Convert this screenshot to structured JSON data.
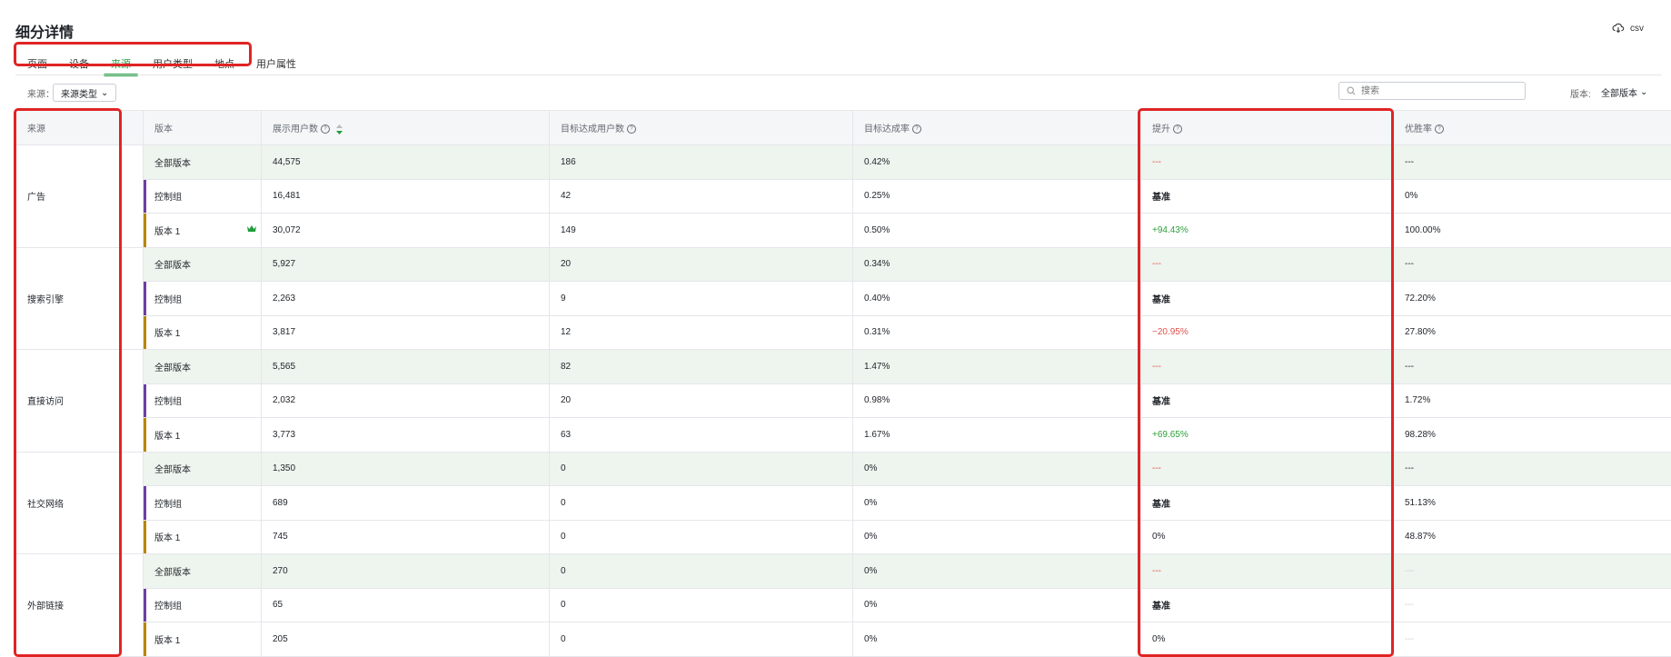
{
  "page": {
    "title": "细分详情",
    "export_label": "csv"
  },
  "tabs": [
    {
      "label": "页面",
      "active": false
    },
    {
      "label": "设备",
      "active": false
    },
    {
      "label": "来源",
      "active": true
    },
    {
      "label": "用户类型",
      "active": false
    },
    {
      "label": "地点",
      "active": false
    },
    {
      "label": "用户属性",
      "active": false
    }
  ],
  "filters": {
    "source_label": "来源：",
    "source_select": "来源类型",
    "search_placeholder": "搜索",
    "version_label": "版本:",
    "version_select": "全部版本"
  },
  "table": {
    "headers": {
      "source": "来源",
      "version": "版本",
      "shown_users": "展示用户数",
      "goal_users": "目标达成用户数",
      "goal_rate": "目标达成率",
      "lift": "提升",
      "win_rate": "优胜率"
    },
    "groups": [
      {
        "source": "广告",
        "rows": [
          {
            "version": "全部版本",
            "shown": "44,575",
            "goal": "186",
            "rate": "0.42%",
            "lift": "---",
            "win": "---"
          },
          {
            "version": "控制组",
            "shown": "16,481",
            "goal": "42",
            "rate": "0.25%",
            "lift": "基准",
            "win": "0%"
          },
          {
            "version": "版本 1",
            "shown": "30,072",
            "goal": "149",
            "rate": "0.50%",
            "lift": "+94.43%",
            "win": "100.00%"
          }
        ]
      },
      {
        "source": "搜索引擎",
        "rows": [
          {
            "version": "全部版本",
            "shown": "5,927",
            "goal": "20",
            "rate": "0.34%",
            "lift": "---",
            "win": "---"
          },
          {
            "version": "控制组",
            "shown": "2,263",
            "goal": "9",
            "rate": "0.40%",
            "lift": "基准",
            "win": "72.20%"
          },
          {
            "version": "版本 1",
            "shown": "3,817",
            "goal": "12",
            "rate": "0.31%",
            "lift": "−20.95%",
            "win": "27.80%"
          }
        ]
      },
      {
        "source": "直接访问",
        "rows": [
          {
            "version": "全部版本",
            "shown": "5,565",
            "goal": "82",
            "rate": "1.47%",
            "lift": "---",
            "win": "---"
          },
          {
            "version": "控制组",
            "shown": "2,032",
            "goal": "20",
            "rate": "0.98%",
            "lift": "基准",
            "win": "1.72%"
          },
          {
            "version": "版本 1",
            "shown": "3,773",
            "goal": "63",
            "rate": "1.67%",
            "lift": "+69.65%",
            "win": "98.28%"
          }
        ]
      },
      {
        "source": "社交网络",
        "rows": [
          {
            "version": "全部版本",
            "shown": "1,350",
            "goal": "0",
            "rate": "0%",
            "lift": "---",
            "win": "---"
          },
          {
            "version": "控制组",
            "shown": "689",
            "goal": "0",
            "rate": "0%",
            "lift": "基准",
            "win": "51.13%"
          },
          {
            "version": "版本 1",
            "shown": "745",
            "goal": "0",
            "rate": "0%",
            "lift": "0%",
            "win": "48.87%"
          }
        ]
      },
      {
        "source": "外部链接",
        "rows": [
          {
            "version": "全部版本",
            "shown": "270",
            "goal": "0",
            "rate": "0%",
            "lift": "---",
            "win": "---"
          },
          {
            "version": "控制组",
            "shown": "65",
            "goal": "0",
            "rate": "0%",
            "lift": "基准",
            "win": "---"
          },
          {
            "version": "版本 1",
            "shown": "205",
            "goal": "0",
            "rate": "0%",
            "lift": "0%",
            "win": "---"
          }
        ]
      }
    ]
  },
  "colors": {
    "accent": "#1f9d3b",
    "positive": "#2e9e3b",
    "negative": "#e0504a",
    "highlight": "#e02424"
  }
}
